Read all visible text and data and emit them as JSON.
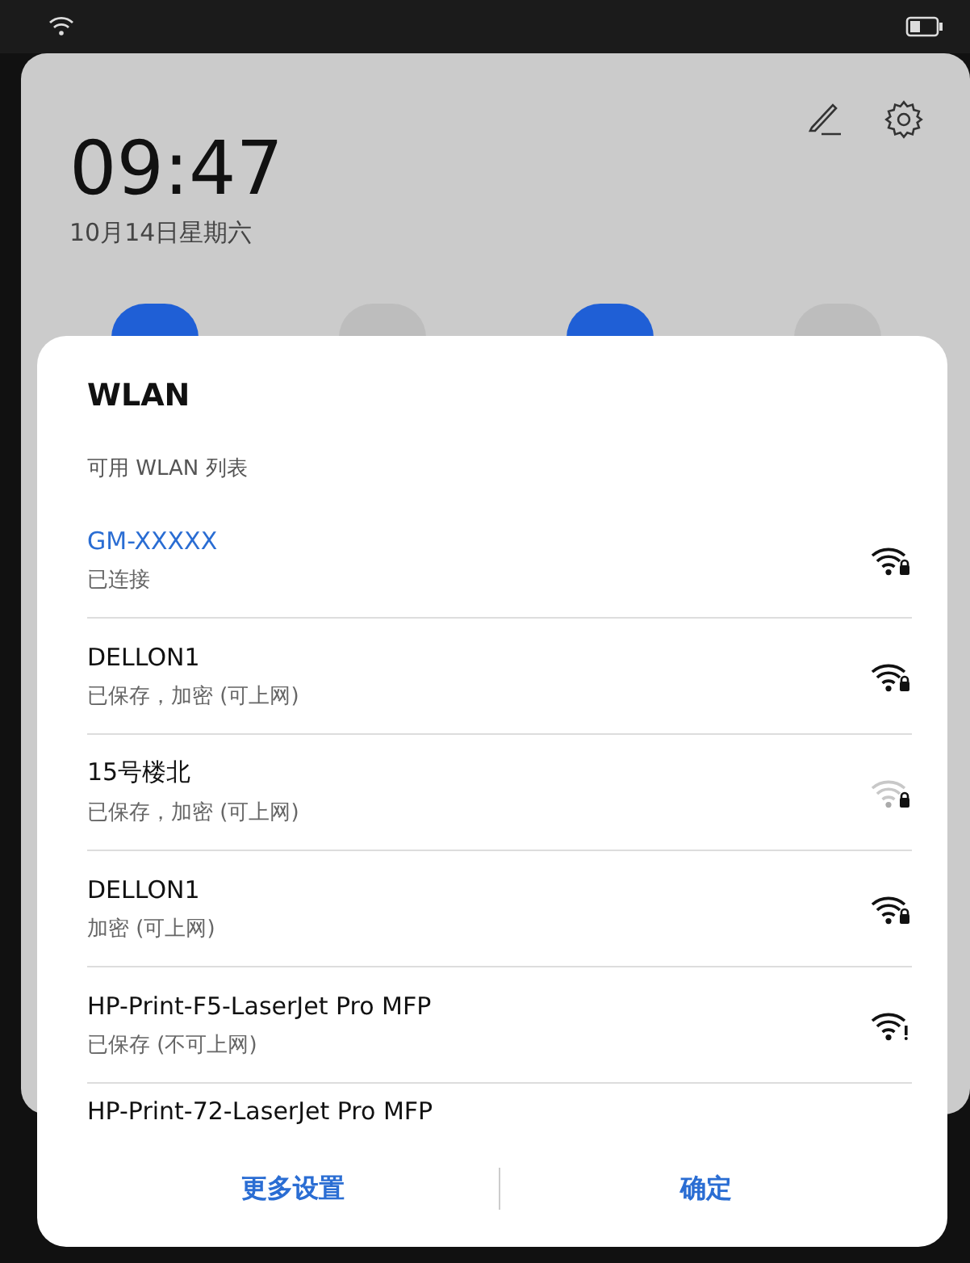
{
  "panel": {
    "time": "09:47",
    "date": "10月14日星期六",
    "toggles": [
      {
        "on": true
      },
      {
        "on": false
      },
      {
        "on": true
      },
      {
        "on": false
      }
    ]
  },
  "dialog": {
    "title": "WLAN",
    "subtitle": "可用 WLAN 列表",
    "networks": [
      {
        "kind": "secured",
        "name": "GM-XXXXX",
        "status": "已连接",
        "connected": true
      },
      {
        "kind": "secured",
        "name": "DELLON1",
        "status": "已保存，加密 (可上网)",
        "connected": false
      },
      {
        "kind": "faint",
        "name": "15号楼北",
        "status": "已保存，加密 (可上网)",
        "connected": false
      },
      {
        "kind": "secured",
        "name": "DELLON1",
        "status": "加密 (可上网)",
        "connected": false
      },
      {
        "kind": "noaccess",
        "name": "HP-Print-F5-LaserJet Pro MFP",
        "status": "已保存 (不可上网)",
        "connected": false
      },
      {
        "kind": "partial",
        "name": "HP-Print-72-LaserJet Pro MFP",
        "connected": false
      }
    ],
    "buttons": [
      "更多设置",
      "确定"
    ]
  }
}
